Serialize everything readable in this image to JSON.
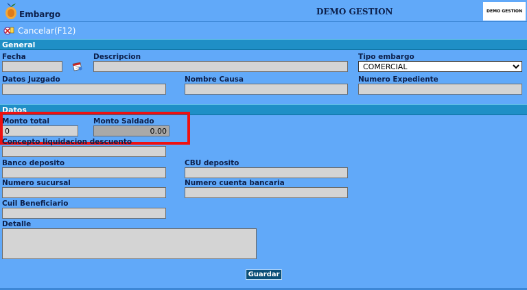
{
  "header": {
    "app_title": "Embargo",
    "center_title": "DEMO GESTION",
    "brand_text": "DEMO GESTION"
  },
  "toolbar": {
    "cancel_label": "Cancelar(F12)"
  },
  "sections": {
    "general": "General",
    "datos": "Datos"
  },
  "general": {
    "fecha": {
      "label": "Fecha",
      "value": ""
    },
    "descripcion": {
      "label": "Descripcion",
      "value": ""
    },
    "tipo_embargo": {
      "label": "Tipo embargo",
      "value": "COMERCIAL",
      "options": [
        "COMERCIAL"
      ]
    },
    "datos_juzgado": {
      "label": "Datos Juzgado",
      "value": ""
    },
    "nombre_causa": {
      "label": "Nombre Causa",
      "value": ""
    },
    "numero_expediente": {
      "label": "Numero Expediente",
      "value": ""
    }
  },
  "datos": {
    "monto_total": {
      "label": "Monto total",
      "value": "0"
    },
    "monto_saldado": {
      "label": "Monto Saldado",
      "value": "0.00"
    },
    "concepto": {
      "label": "Concepto liquidacion descuento",
      "value": ""
    },
    "banco_deposito": {
      "label": "Banco deposito",
      "value": ""
    },
    "cbu_deposito": {
      "label": "CBU deposito",
      "value": ""
    },
    "numero_sucursal": {
      "label": "Numero sucursal",
      "value": ""
    },
    "numero_cuenta": {
      "label": "Numero cuenta bancaria",
      "value": ""
    },
    "cuil_beneficiario": {
      "label": "Cuil Beneficiario",
      "value": ""
    },
    "detalle": {
      "label": "Detalle",
      "value": ""
    }
  },
  "actions": {
    "save_label": "Guardar"
  },
  "colors": {
    "background": "#61a9f9",
    "section_header": "#1f8fc6",
    "highlight": "#ee1111",
    "save_button": "#0b4f78"
  },
  "icons": {
    "app": "app-logo-icon",
    "cancel": "cancel-icon",
    "calendar": "calendar-icon"
  }
}
